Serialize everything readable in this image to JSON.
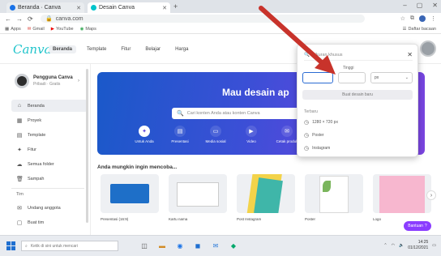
{
  "browser": {
    "tabs": [
      {
        "title": "Beranda · Canva",
        "favicon_color": "#1a73e8"
      },
      {
        "title": "Desain Canva",
        "favicon_color": "#00c4cc"
      }
    ],
    "new_tab": "+",
    "window_controls": [
      "–",
      "▢",
      "✕"
    ],
    "nav": [
      "←",
      "→",
      "⟳"
    ],
    "url": "canva.com",
    "bookmarks": [
      "Apps",
      "Gmail",
      "YouTube",
      "Maps"
    ],
    "reading_list": "Daftar bacaan"
  },
  "header": {
    "logo": "Canva",
    "nav": [
      "Beranda",
      "Template",
      "Fitur",
      "Belajar",
      "Harga"
    ],
    "close": "✕"
  },
  "sidebar": {
    "profile": {
      "name": "Pengguna Canva",
      "sub": "Pribadi · Gratis"
    },
    "items": [
      {
        "icon": "⌂",
        "label": "Beranda"
      },
      {
        "icon": "▦",
        "label": "Proyek"
      },
      {
        "icon": "▤",
        "label": "Template"
      },
      {
        "icon": "✦",
        "label": "Fitur"
      },
      {
        "icon": "☁",
        "label": "Semua folder"
      },
      {
        "icon": "🗑",
        "label": "Sampah"
      }
    ],
    "section_label": "Tim",
    "bottom_items": [
      {
        "icon": "✉",
        "label": "Undang anggota"
      },
      {
        "icon": "▢",
        "label": "Buat tim"
      }
    ]
  },
  "hero": {
    "title": "Mau desain ap",
    "search_placeholder": "Cari konten Anda atau konten Canva",
    "categories": [
      {
        "icon": "✦",
        "label": "Untuk Anda"
      },
      {
        "icon": "▤",
        "label": "Presentasi"
      },
      {
        "icon": "▭",
        "label": "Media sosial"
      },
      {
        "icon": "▶",
        "label": "Video"
      },
      {
        "icon": "✉",
        "label": "Cetak produk"
      }
    ]
  },
  "section_title": "Anda mungkin ingin mencoba...",
  "tiles": [
    {
      "label": "Presentasi (16:9)"
    },
    {
      "label": "Kartu nama"
    },
    {
      "label": "Post Instagram"
    },
    {
      "label": "Poster"
    },
    {
      "label": "Logo"
    }
  ],
  "help_button": "Bantuan",
  "dropdown": {
    "search_placeholder": "Ukuran khusus",
    "units_label": "Tinggi",
    "unit_select": "px",
    "create_button": "Buat desain baru",
    "recent_label": "Terbaru",
    "recent_items": [
      "1280 × 720 px",
      "Poster",
      "Instagram"
    ]
  },
  "taskbar": {
    "search_placeholder": "Ketik di sini untuk mencari",
    "apps": [
      {
        "icon": "◫",
        "color": "#555555"
      },
      {
        "icon": "▬",
        "color": "#d28b26"
      },
      {
        "icon": "◉",
        "color": "#1a73e8"
      },
      {
        "icon": "◼",
        "color": "#1f6fd1"
      },
      {
        "icon": "✉",
        "color": "#2a7ad9"
      },
      {
        "icon": "◆",
        "color": "#00a86b"
      }
    ],
    "time": "14:25",
    "date": "01/12/2021"
  },
  "accent": "#8b3dff"
}
